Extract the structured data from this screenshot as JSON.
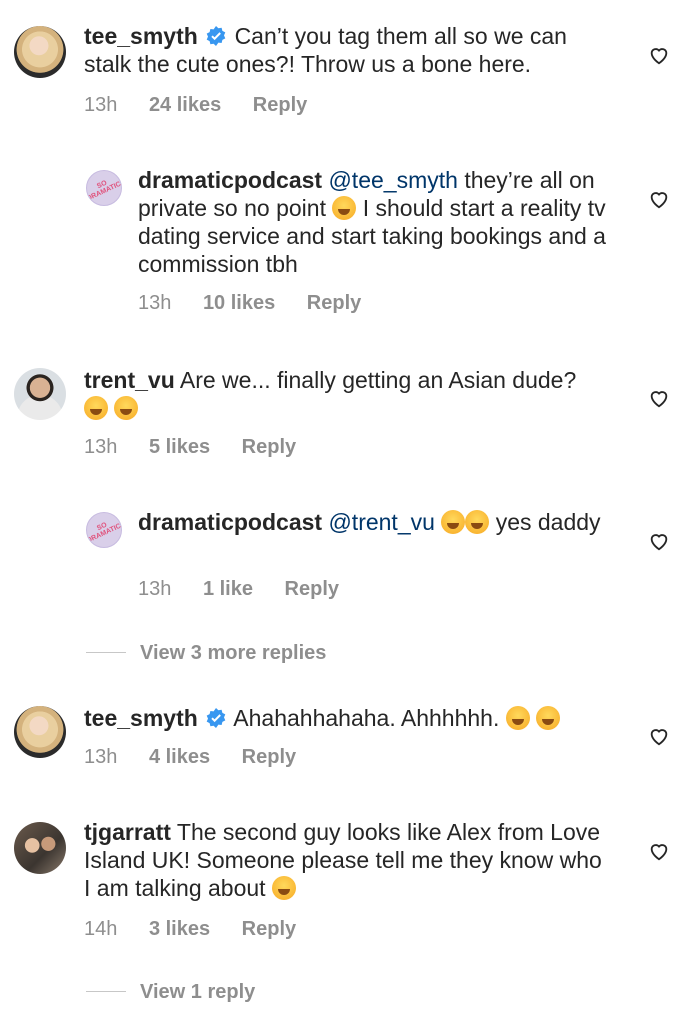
{
  "comments": [
    {
      "user": "tee_smyth",
      "text_a": "Can’t you tag them all so we can stalk the cute ones?! Throw us a bone here.",
      "time": "13h",
      "likes": "24 likes",
      "reply": "Reply"
    },
    {
      "user": "dramaticpodcast",
      "mention": "@tee_smyth",
      "text_a": "they’re all on private so no point",
      "text_b": "I should start a reality tv dating service and start taking bookings and a commission tbh",
      "time": "13h",
      "likes": "10 likes",
      "reply": "Reply"
    },
    {
      "user": "trent_vu",
      "text_a": "Are we... finally getting an Asian dude?",
      "time": "13h",
      "likes": "5 likes",
      "reply": "Reply"
    },
    {
      "user": "dramaticpodcast",
      "mention": "@trent_vu",
      "text_a": "yes daddy",
      "time": "13h",
      "likes": "1 like",
      "reply": "Reply"
    },
    {
      "user": "tee_smyth",
      "text_a": "Ahahahhahaha. Ahhhhhh.",
      "time": "13h",
      "likes": "4 likes",
      "reply": "Reply"
    },
    {
      "user": "tjgarratt",
      "text_a": "The second guy looks like Alex from Love Island UK! Someone please tell me they know who I am talking about",
      "time": "14h",
      "likes": "3 likes",
      "reply": "Reply"
    }
  ],
  "view_more_1": "View 3 more replies",
  "view_more_2": "View 1 reply",
  "avatar_badge": "SO DRAMATIC!",
  "icons": {
    "verified": "verified-badge-icon",
    "like": "heart-outline-icon"
  },
  "colors": {
    "text": "#262626",
    "meta": "#8e8e8e",
    "mention": "#003569",
    "verified": "#3897f0"
  }
}
